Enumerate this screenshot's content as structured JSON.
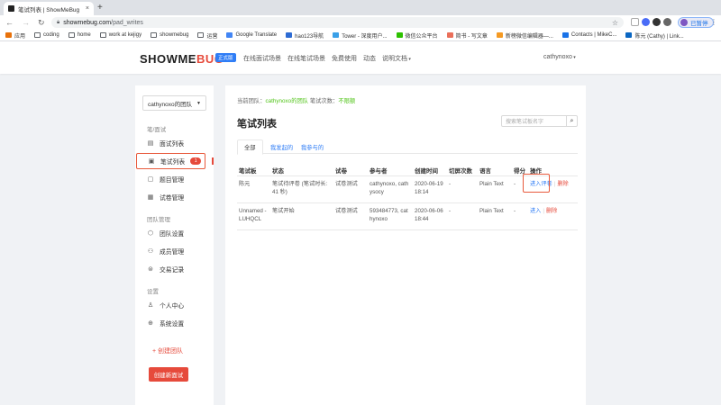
{
  "browser": {
    "tab_title": "笔试列表 | ShowMeBug",
    "tab_close": "×",
    "new_tab": "+",
    "url_host": "showmebug.com",
    "url_path": "/pad_writes",
    "profile_label": "已暂停",
    "bookmarks": [
      {
        "label": "应用",
        "icon": "apps-icon"
      },
      {
        "label": "coding",
        "icon": "folder-icon"
      },
      {
        "label": "home",
        "icon": "folder-icon"
      },
      {
        "label": "work at kejigy",
        "icon": "folder-icon"
      },
      {
        "label": "showmebug",
        "icon": "folder-icon"
      },
      {
        "label": "运营",
        "icon": "folder-icon"
      },
      {
        "label": "Google Translate",
        "icon": "translate-icon"
      },
      {
        "label": "hao123导航",
        "icon": "hao123-icon"
      },
      {
        "label": "Tower - 深度用户...",
        "icon": "tower-icon"
      },
      {
        "label": "微信公众平台",
        "icon": "wechat-icon"
      },
      {
        "label": "简书 - 写文章",
        "icon": "jianshu-icon"
      },
      {
        "label": "新榜微信编辑器—...",
        "icon": "newrank-icon"
      },
      {
        "label": "Contacts | MikeC...",
        "icon": "contacts-icon"
      },
      {
        "label": "陈元 (Cathy) | Link...",
        "icon": "linkedin-icon"
      }
    ]
  },
  "header": {
    "logo_main": "SHOWME",
    "logo_bug": "BUG",
    "edition": "正式版",
    "nav": [
      "在线面试场景",
      "在线笔试场景",
      "免费使用",
      "动态",
      "说明文档"
    ],
    "user": "cathynoxo"
  },
  "sidebar": {
    "team": "cathynoxo的团队",
    "section_interview": "笔/面试",
    "items_interview": [
      {
        "label": "面试列表",
        "icon": "list-icon"
      },
      {
        "label": "笔试列表",
        "icon": "written-test-icon",
        "badge": "1"
      },
      {
        "label": "题目管理",
        "icon": "question-icon"
      },
      {
        "label": "试卷管理",
        "icon": "paper-icon"
      }
    ],
    "section_team": "团队管理",
    "items_team": [
      {
        "label": "团队设置",
        "icon": "team-settings-icon"
      },
      {
        "label": "成员管理",
        "icon": "members-icon"
      },
      {
        "label": "交易记录",
        "icon": "transactions-icon"
      }
    ],
    "section_settings": "设置",
    "items_settings": [
      {
        "label": "个人中心",
        "icon": "user-icon"
      },
      {
        "label": "系统设置",
        "icon": "system-settings-icon"
      }
    ],
    "create_team": "+ 创建团队",
    "create_interview": "创建新面试"
  },
  "main": {
    "ctx_prefix": "当前团队：",
    "ctx_team": "cathynoxo的团队",
    "ctx_count_label": " 笔试次数：",
    "ctx_count": "不限额",
    "title": "笔试列表",
    "search_placeholder": "搜索笔试板名字",
    "tabs": [
      "全部",
      "我发起的",
      "我参与的"
    ],
    "columns": [
      "笔试板",
      "状态",
      "试卷",
      "参与者",
      "创建时间",
      "切屏次数",
      "语言",
      "得分",
      "操作"
    ],
    "rows": [
      {
        "board": "陈元",
        "status": "笔试待评卷 (笔试时长: 41 秒)",
        "paper": "试卷测试",
        "participants": "cathynoxo, cathysocy",
        "created": "2020-06-19 18:14",
        "switches": "-",
        "language": "Plain Text",
        "score": "-",
        "action": "进入评卷",
        "delete": "删除"
      },
      {
        "board": "Unnamed - LUHQCL",
        "status": "笔试开始",
        "paper": "试卷测试",
        "participants": "593484773, cathynoxo",
        "created": "2020-06-06 18:44",
        "switches": "-",
        "language": "Plain Text",
        "score": "-",
        "action": "进入",
        "delete": "删除"
      }
    ]
  },
  "colors": {
    "accent": "#2f7df6",
    "brand_red": "#e64a3b",
    "highlight": "#e85a3c",
    "success": "#52c41a"
  }
}
